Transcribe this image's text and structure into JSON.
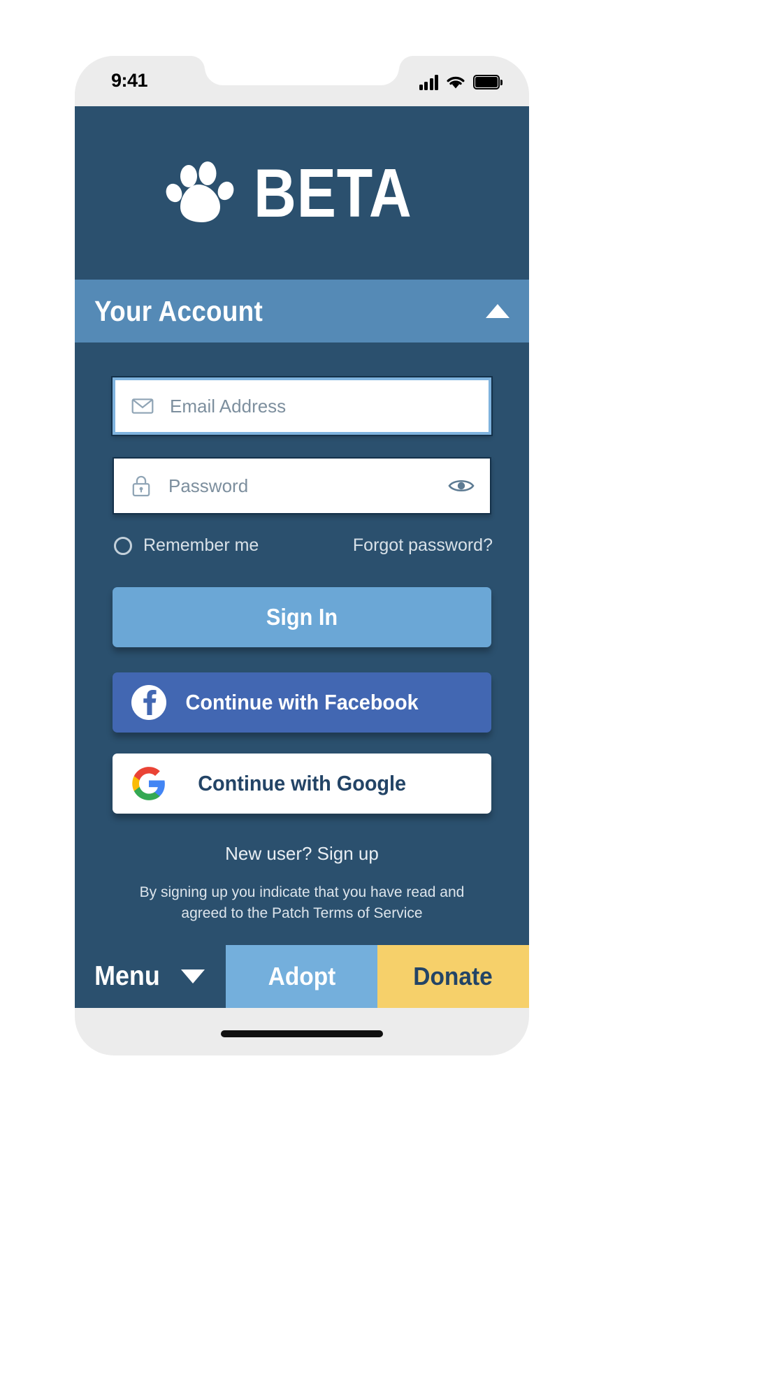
{
  "status_bar": {
    "time": "9:41",
    "signal_icon": "signal-bars-icon",
    "wifi_icon": "wifi-icon",
    "battery_icon": "battery-full-icon"
  },
  "brand": {
    "logo_icon": "paw-print-icon",
    "name": "BETA"
  },
  "account_section": {
    "title": "Your Account",
    "collapse_icon": "triangle-up-icon"
  },
  "form": {
    "email": {
      "placeholder": "Email Address",
      "value": "",
      "icon": "envelope-icon",
      "focused": true
    },
    "password": {
      "placeholder": "Password",
      "value": "",
      "icon": "lock-icon",
      "reveal_icon": "eye-icon"
    },
    "remember_me": {
      "label": "Remember me",
      "checked": false,
      "icon": "radio-unchecked-icon"
    },
    "forgot_password": "Forgot password?"
  },
  "actions": {
    "sign_in": "Sign In",
    "facebook": {
      "label": "Continue with Facebook",
      "icon": "facebook-icon"
    },
    "google": {
      "label": "Continue with Google",
      "icon": "google-icon"
    }
  },
  "footer": {
    "signup_prompt": "New user? Sign up",
    "legal_line1": "By signing up you indicate that you have read and",
    "legal_line2": "agreed to the Patch Terms of Service"
  },
  "bottom_nav": {
    "menu": "Menu",
    "menu_icon": "triangle-down-icon",
    "adopt": "Adopt",
    "donate": "Donate"
  },
  "colors": {
    "brand_navy": "#2b506e",
    "accent_blue": "#558ab6",
    "signin_blue": "#6ba7d6",
    "facebook_blue": "#4267b2",
    "donate_yellow": "#f6d06a",
    "adopt_blue": "#74afdc"
  }
}
